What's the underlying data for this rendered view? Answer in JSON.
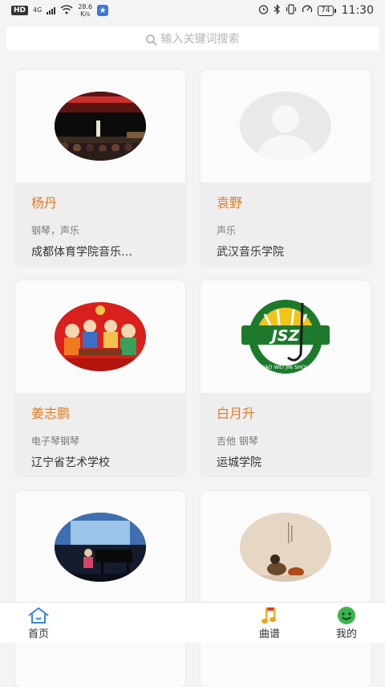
{
  "status": {
    "hd": "HD",
    "net_type": "4G",
    "speed_value": "28.6",
    "speed_unit": "K/s",
    "battery": "74",
    "time": "11:30"
  },
  "search": {
    "placeholder": "输入关键词搜索"
  },
  "teachers": [
    {
      "name": "杨丹",
      "tags": "钢琴，声乐",
      "school": "成都体育学院音乐…"
    },
    {
      "name": "袁野",
      "tags": "声乐",
      "school": "武汉音乐学院"
    },
    {
      "name": "姜志鹏",
      "tags": "电子琴钢琴",
      "school": "辽宁省艺术学校"
    },
    {
      "name": "白月升",
      "tags": "吉他 钢琴",
      "school": "运城学院"
    },
    {
      "name": "",
      "tags": "",
      "school": ""
    },
    {
      "name": "",
      "tags": "",
      "school": ""
    }
  ],
  "logo": {
    "text": "JSZ",
    "ring_text": "YU XIAO WEI JIN SHOU ZHI"
  },
  "tabs": [
    {
      "label": "首页",
      "icon": "home-icon"
    },
    {
      "label": "曲谱",
      "icon": "music-note-icon"
    },
    {
      "label": "我的",
      "icon": "smiley-icon"
    }
  ],
  "colors": {
    "accent": "#e07b26",
    "tab_green": "#3ab54a"
  }
}
